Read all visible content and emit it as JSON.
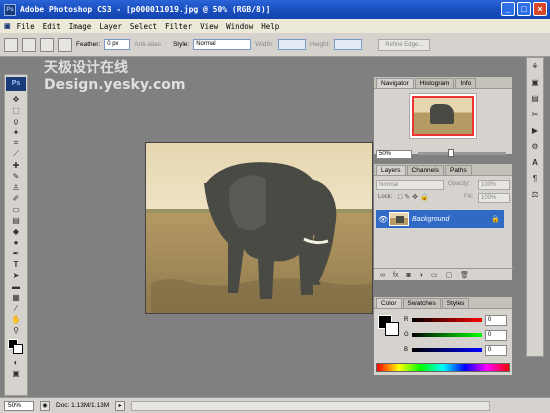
{
  "window": {
    "title": "Adobe Photoshop CS3 - [p000011019.jpg @ 50% (RGB/8)]",
    "app_icon": "Ps"
  },
  "menu": [
    "File",
    "Edit",
    "Image",
    "Layer",
    "Select",
    "Filter",
    "View",
    "Window",
    "Help"
  ],
  "options": {
    "feather_label": "Feather:",
    "feather_value": "0 px",
    "antialias_label": "Anti-alias",
    "style_label": "Style:",
    "style_value": "Normal",
    "width_label": "Width:",
    "height_label": "Height:",
    "refine_button": "Refine Edge..."
  },
  "toolbox": {
    "logo": "Ps"
  },
  "watermark": {
    "line1": "天极设计在线",
    "line2": "Design.yesky.com"
  },
  "navigator": {
    "tabs": [
      "Navigator",
      "Histogram",
      "Info"
    ],
    "zoom": "50%"
  },
  "layers": {
    "tabs": [
      "Layers",
      "Channels",
      "Paths"
    ],
    "blend_mode": "Normal",
    "opacity_label": "Opacity:",
    "opacity_value": "100%",
    "lock_label": "Lock:",
    "fill_label": "Fill:",
    "fill_value": "100%",
    "layer_name": "Background"
  },
  "color": {
    "tabs": [
      "Color",
      "Swatches",
      "Styles"
    ],
    "r_label": "R",
    "g_label": "G",
    "b_label": "B",
    "r_value": "0",
    "g_value": "0",
    "b_value": "0"
  },
  "status": {
    "zoom": "50%",
    "doc": "Doc: 1.13M/1.13M"
  }
}
